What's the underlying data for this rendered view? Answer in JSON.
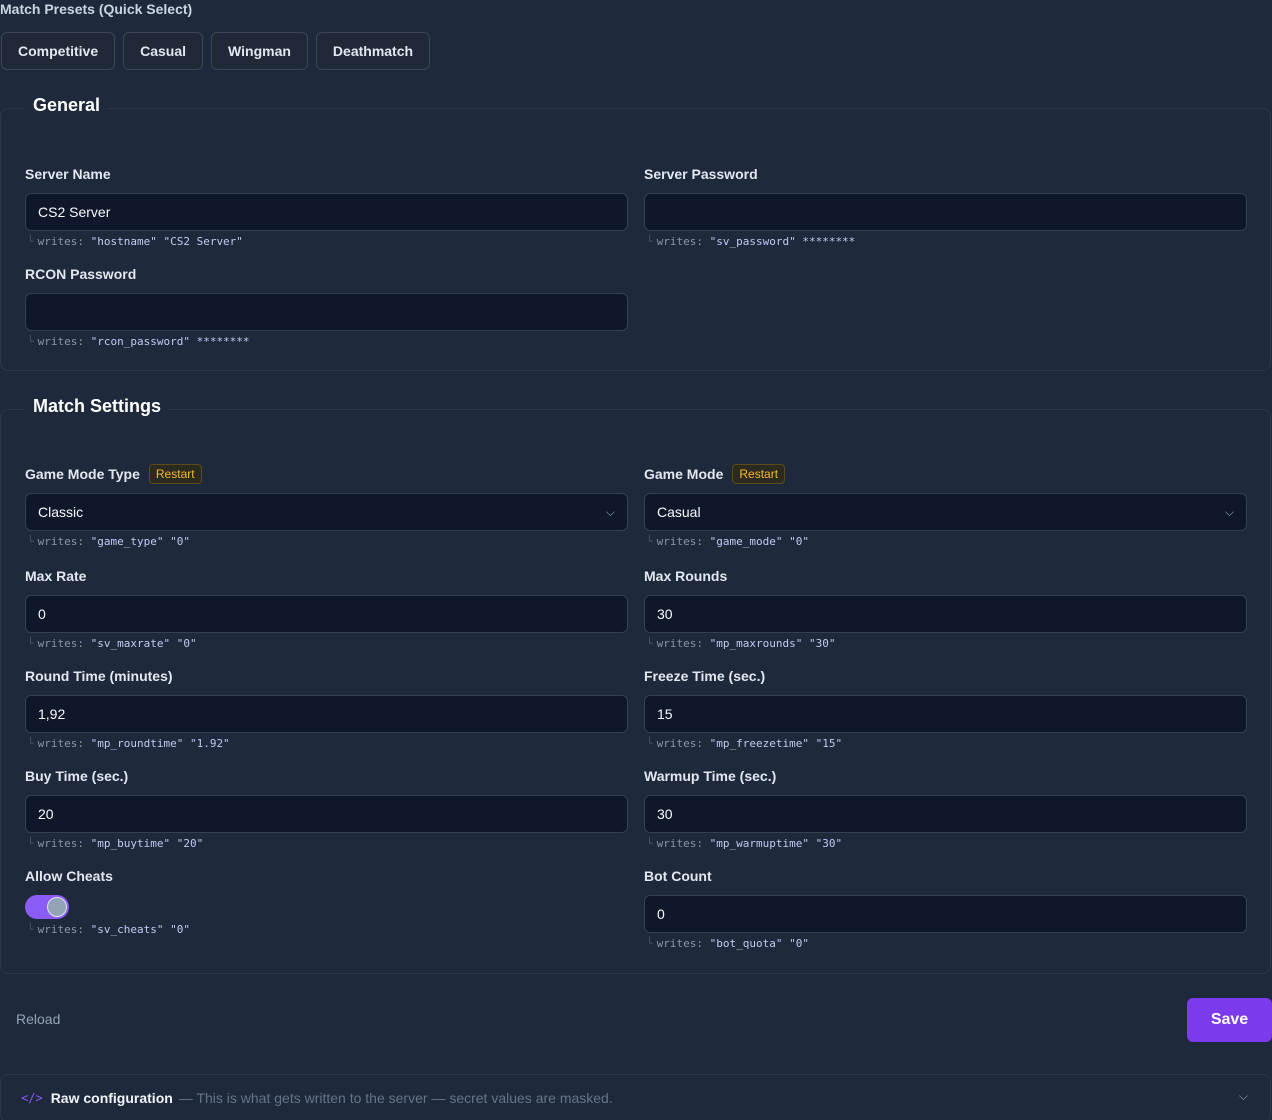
{
  "presets": {
    "label": "Match Presets (Quick Select)",
    "buttons": [
      "Competitive",
      "Casual",
      "Wingman",
      "Deathmatch"
    ]
  },
  "general": {
    "title": "General",
    "server_name": {
      "label": "Server Name",
      "value": "CS2 Server",
      "hint_prefix": "writes: ",
      "hint_value": "\"hostname\" \"CS2 Server\""
    },
    "server_password": {
      "label": "Server Password",
      "value": "",
      "hint_prefix": "writes: ",
      "hint_value": "\"sv_password\" ********"
    },
    "rcon_password": {
      "label": "RCON Password",
      "value": "",
      "hint_prefix": "writes: ",
      "hint_value": "\"rcon_password\" ********"
    }
  },
  "match": {
    "title": "Match Settings",
    "restart_badge": "Restart",
    "game_mode_type": {
      "label": "Game Mode Type",
      "value": "Classic",
      "hint_prefix": "writes: ",
      "hint_value": "\"game_type\" \"0\""
    },
    "game_mode": {
      "label": "Game Mode",
      "value": "Casual",
      "hint_prefix": "writes: ",
      "hint_value": "\"game_mode\" \"0\""
    },
    "max_rate": {
      "label": "Max Rate",
      "value": "0",
      "hint_prefix": "writes: ",
      "hint_value": "\"sv_maxrate\" \"0\""
    },
    "max_rounds": {
      "label": "Max Rounds",
      "value": "30",
      "hint_prefix": "writes: ",
      "hint_value": "\"mp_maxrounds\" \"30\""
    },
    "round_time": {
      "label": "Round Time (minutes)",
      "value": "1,92",
      "hint_prefix": "writes: ",
      "hint_value": "\"mp_roundtime\" \"1.92\""
    },
    "freeze_time": {
      "label": "Freeze Time (sec.)",
      "value": "15",
      "hint_prefix": "writes: ",
      "hint_value": "\"mp_freezetime\" \"15\""
    },
    "buy_time": {
      "label": "Buy Time (sec.)",
      "value": "20",
      "hint_prefix": "writes: ",
      "hint_value": "\"mp_buytime\" \"20\""
    },
    "warmup_time": {
      "label": "Warmup Time (sec.)",
      "value": "30",
      "hint_prefix": "writes: ",
      "hint_value": "\"mp_warmuptime\" \"30\""
    },
    "allow_cheats": {
      "label": "Allow Cheats",
      "enabled": true,
      "hint_prefix": "writes: ",
      "hint_value": "\"sv_cheats\" \"0\""
    },
    "bot_count": {
      "label": "Bot Count",
      "value": "0",
      "hint_prefix": "writes: ",
      "hint_value": "\"bot_quota\" \"0\""
    }
  },
  "actions": {
    "reload": "Reload",
    "save": "Save"
  },
  "raw_config": {
    "title": "Raw configuration",
    "description": "— This is what gets written to the server — secret values are masked."
  },
  "colors": {
    "accent": "#7c3aed",
    "toggle_on": "#8b5cf6",
    "badge": "#f5b92c",
    "background": "#1e293b",
    "input": "#0f172a"
  },
  "icons": {
    "corner": "corner-icon",
    "chevron": "chevron-down-icon",
    "code": "code-icon"
  }
}
